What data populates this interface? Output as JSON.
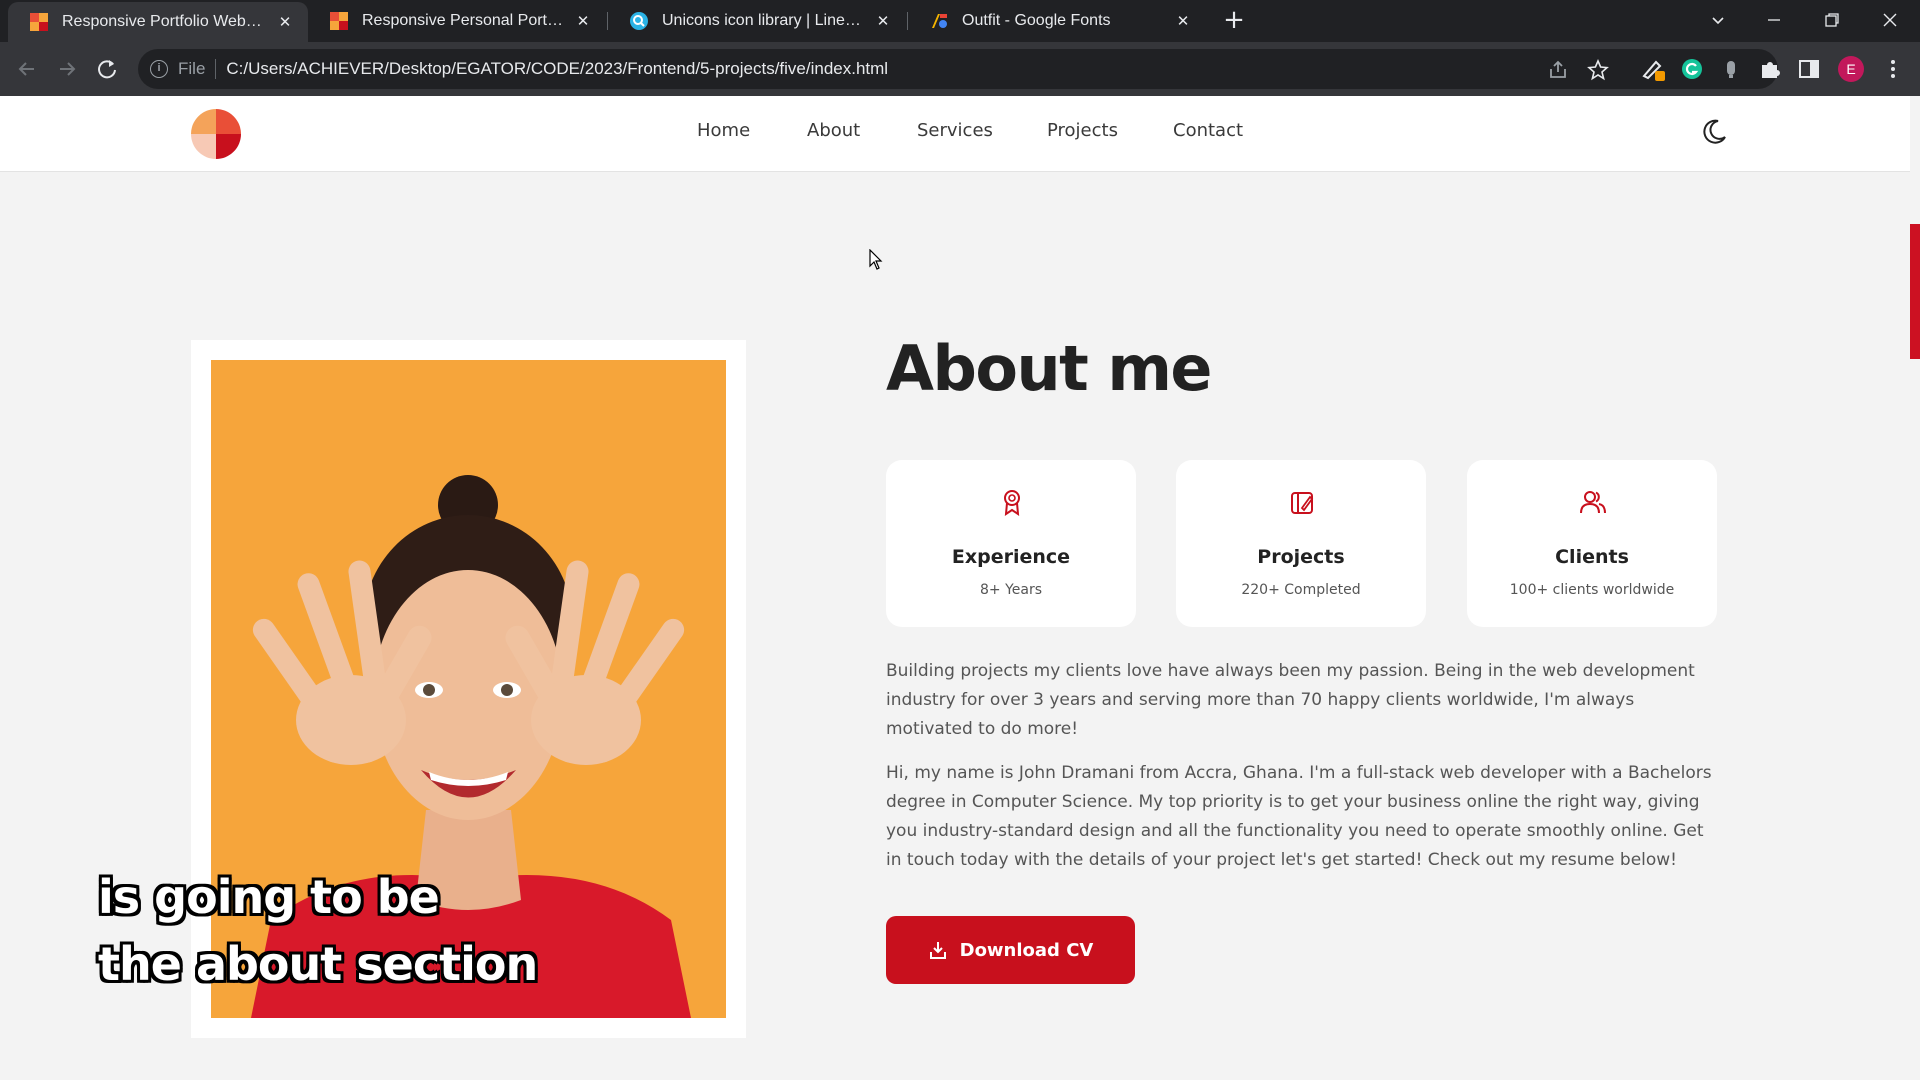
{
  "browser": {
    "tabs": [
      {
        "title": "Responsive Portfolio Website",
        "active": true
      },
      {
        "title": "Responsive Personal Portfolio We",
        "active": false
      },
      {
        "title": "Unicons icon library | Line | Mond",
        "active": false
      },
      {
        "title": "Outfit - Google Fonts",
        "active": false
      }
    ],
    "new_tab_icon": "plus-icon",
    "address_scheme": "File",
    "address_url": "C:/Users/ACHIEVER/Desktop/EGATOR/CODE/2023/Frontend/5-projects/five/index.html",
    "profile_initial": "E"
  },
  "site": {
    "nav": {
      "home": "Home",
      "about": "About",
      "services": "Services",
      "projects": "Projects",
      "contact": "Contact"
    },
    "about": {
      "title": "About me",
      "cards": [
        {
          "icon": "award-icon",
          "title": "Experience",
          "subtitle": "8+ Years"
        },
        {
          "icon": "briefcase-icon",
          "title": "Projects",
          "subtitle": "220+ Completed"
        },
        {
          "icon": "users-icon",
          "title": "Clients",
          "subtitle": "100+ clients worldwide"
        }
      ],
      "paragraph1": "Building projects my clients love have always been my passion. Being in the web development industry for over 3 years and serving more than 70 happy clients worldwide, I'm always motivated to do more!",
      "paragraph2": "Hi, my name is John Dramani from Accra, Ghana. I'm a full-stack web developer with a Bachelors degree in Computer Science. My top priority is to get your business online the right way, giving you industry-standard design and all the functionality you need to operate smoothly online. Get in touch today with the details of your project let's get started! Check out my resume below!",
      "download_label": "Download CV"
    }
  },
  "caption": {
    "line1": "is going to be",
    "line2": "the about section"
  },
  "colors": {
    "accent": "#c8101d",
    "photo_bg": "#f6a53b",
    "page_bg": "#f3f3f3"
  }
}
